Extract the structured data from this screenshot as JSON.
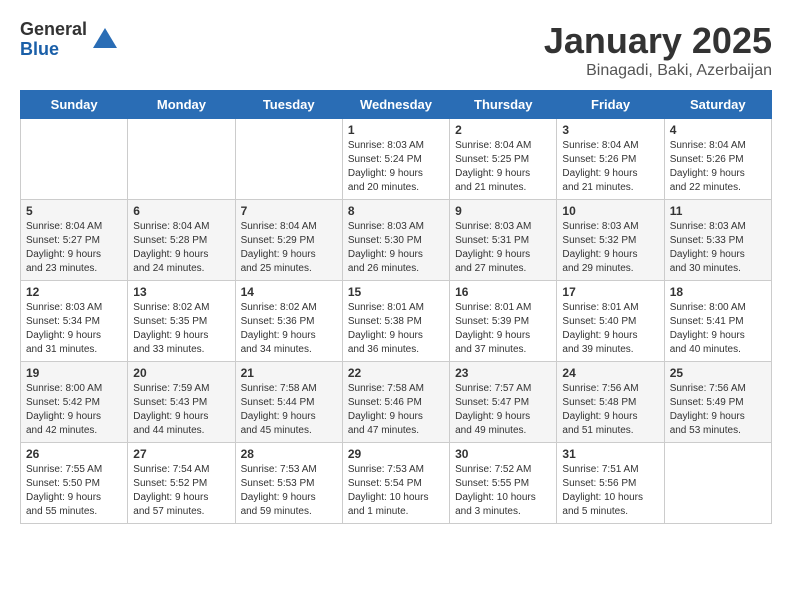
{
  "logo": {
    "general": "General",
    "blue": "Blue"
  },
  "title": "January 2025",
  "subtitle": "Binagadi, Baki, Azerbaijan",
  "days_of_week": [
    "Sunday",
    "Monday",
    "Tuesday",
    "Wednesday",
    "Thursday",
    "Friday",
    "Saturday"
  ],
  "weeks": [
    [
      {
        "day": "",
        "content": ""
      },
      {
        "day": "",
        "content": ""
      },
      {
        "day": "",
        "content": ""
      },
      {
        "day": "1",
        "content": "Sunrise: 8:03 AM\nSunset: 5:24 PM\nDaylight: 9 hours\nand 20 minutes."
      },
      {
        "day": "2",
        "content": "Sunrise: 8:04 AM\nSunset: 5:25 PM\nDaylight: 9 hours\nand 21 minutes."
      },
      {
        "day": "3",
        "content": "Sunrise: 8:04 AM\nSunset: 5:26 PM\nDaylight: 9 hours\nand 21 minutes."
      },
      {
        "day": "4",
        "content": "Sunrise: 8:04 AM\nSunset: 5:26 PM\nDaylight: 9 hours\nand 22 minutes."
      }
    ],
    [
      {
        "day": "5",
        "content": "Sunrise: 8:04 AM\nSunset: 5:27 PM\nDaylight: 9 hours\nand 23 minutes."
      },
      {
        "day": "6",
        "content": "Sunrise: 8:04 AM\nSunset: 5:28 PM\nDaylight: 9 hours\nand 24 minutes."
      },
      {
        "day": "7",
        "content": "Sunrise: 8:04 AM\nSunset: 5:29 PM\nDaylight: 9 hours\nand 25 minutes."
      },
      {
        "day": "8",
        "content": "Sunrise: 8:03 AM\nSunset: 5:30 PM\nDaylight: 9 hours\nand 26 minutes."
      },
      {
        "day": "9",
        "content": "Sunrise: 8:03 AM\nSunset: 5:31 PM\nDaylight: 9 hours\nand 27 minutes."
      },
      {
        "day": "10",
        "content": "Sunrise: 8:03 AM\nSunset: 5:32 PM\nDaylight: 9 hours\nand 29 minutes."
      },
      {
        "day": "11",
        "content": "Sunrise: 8:03 AM\nSunset: 5:33 PM\nDaylight: 9 hours\nand 30 minutes."
      }
    ],
    [
      {
        "day": "12",
        "content": "Sunrise: 8:03 AM\nSunset: 5:34 PM\nDaylight: 9 hours\nand 31 minutes."
      },
      {
        "day": "13",
        "content": "Sunrise: 8:02 AM\nSunset: 5:35 PM\nDaylight: 9 hours\nand 33 minutes."
      },
      {
        "day": "14",
        "content": "Sunrise: 8:02 AM\nSunset: 5:36 PM\nDaylight: 9 hours\nand 34 minutes."
      },
      {
        "day": "15",
        "content": "Sunrise: 8:01 AM\nSunset: 5:38 PM\nDaylight: 9 hours\nand 36 minutes."
      },
      {
        "day": "16",
        "content": "Sunrise: 8:01 AM\nSunset: 5:39 PM\nDaylight: 9 hours\nand 37 minutes."
      },
      {
        "day": "17",
        "content": "Sunrise: 8:01 AM\nSunset: 5:40 PM\nDaylight: 9 hours\nand 39 minutes."
      },
      {
        "day": "18",
        "content": "Sunrise: 8:00 AM\nSunset: 5:41 PM\nDaylight: 9 hours\nand 40 minutes."
      }
    ],
    [
      {
        "day": "19",
        "content": "Sunrise: 8:00 AM\nSunset: 5:42 PM\nDaylight: 9 hours\nand 42 minutes."
      },
      {
        "day": "20",
        "content": "Sunrise: 7:59 AM\nSunset: 5:43 PM\nDaylight: 9 hours\nand 44 minutes."
      },
      {
        "day": "21",
        "content": "Sunrise: 7:58 AM\nSunset: 5:44 PM\nDaylight: 9 hours\nand 45 minutes."
      },
      {
        "day": "22",
        "content": "Sunrise: 7:58 AM\nSunset: 5:46 PM\nDaylight: 9 hours\nand 47 minutes."
      },
      {
        "day": "23",
        "content": "Sunrise: 7:57 AM\nSunset: 5:47 PM\nDaylight: 9 hours\nand 49 minutes."
      },
      {
        "day": "24",
        "content": "Sunrise: 7:56 AM\nSunset: 5:48 PM\nDaylight: 9 hours\nand 51 minutes."
      },
      {
        "day": "25",
        "content": "Sunrise: 7:56 AM\nSunset: 5:49 PM\nDaylight: 9 hours\nand 53 minutes."
      }
    ],
    [
      {
        "day": "26",
        "content": "Sunrise: 7:55 AM\nSunset: 5:50 PM\nDaylight: 9 hours\nand 55 minutes."
      },
      {
        "day": "27",
        "content": "Sunrise: 7:54 AM\nSunset: 5:52 PM\nDaylight: 9 hours\nand 57 minutes."
      },
      {
        "day": "28",
        "content": "Sunrise: 7:53 AM\nSunset: 5:53 PM\nDaylight: 9 hours\nand 59 minutes."
      },
      {
        "day": "29",
        "content": "Sunrise: 7:53 AM\nSunset: 5:54 PM\nDaylight: 10 hours\nand 1 minute."
      },
      {
        "day": "30",
        "content": "Sunrise: 7:52 AM\nSunset: 5:55 PM\nDaylight: 10 hours\nand 3 minutes."
      },
      {
        "day": "31",
        "content": "Sunrise: 7:51 AM\nSunset: 5:56 PM\nDaylight: 10 hours\nand 5 minutes."
      },
      {
        "day": "",
        "content": ""
      }
    ]
  ]
}
